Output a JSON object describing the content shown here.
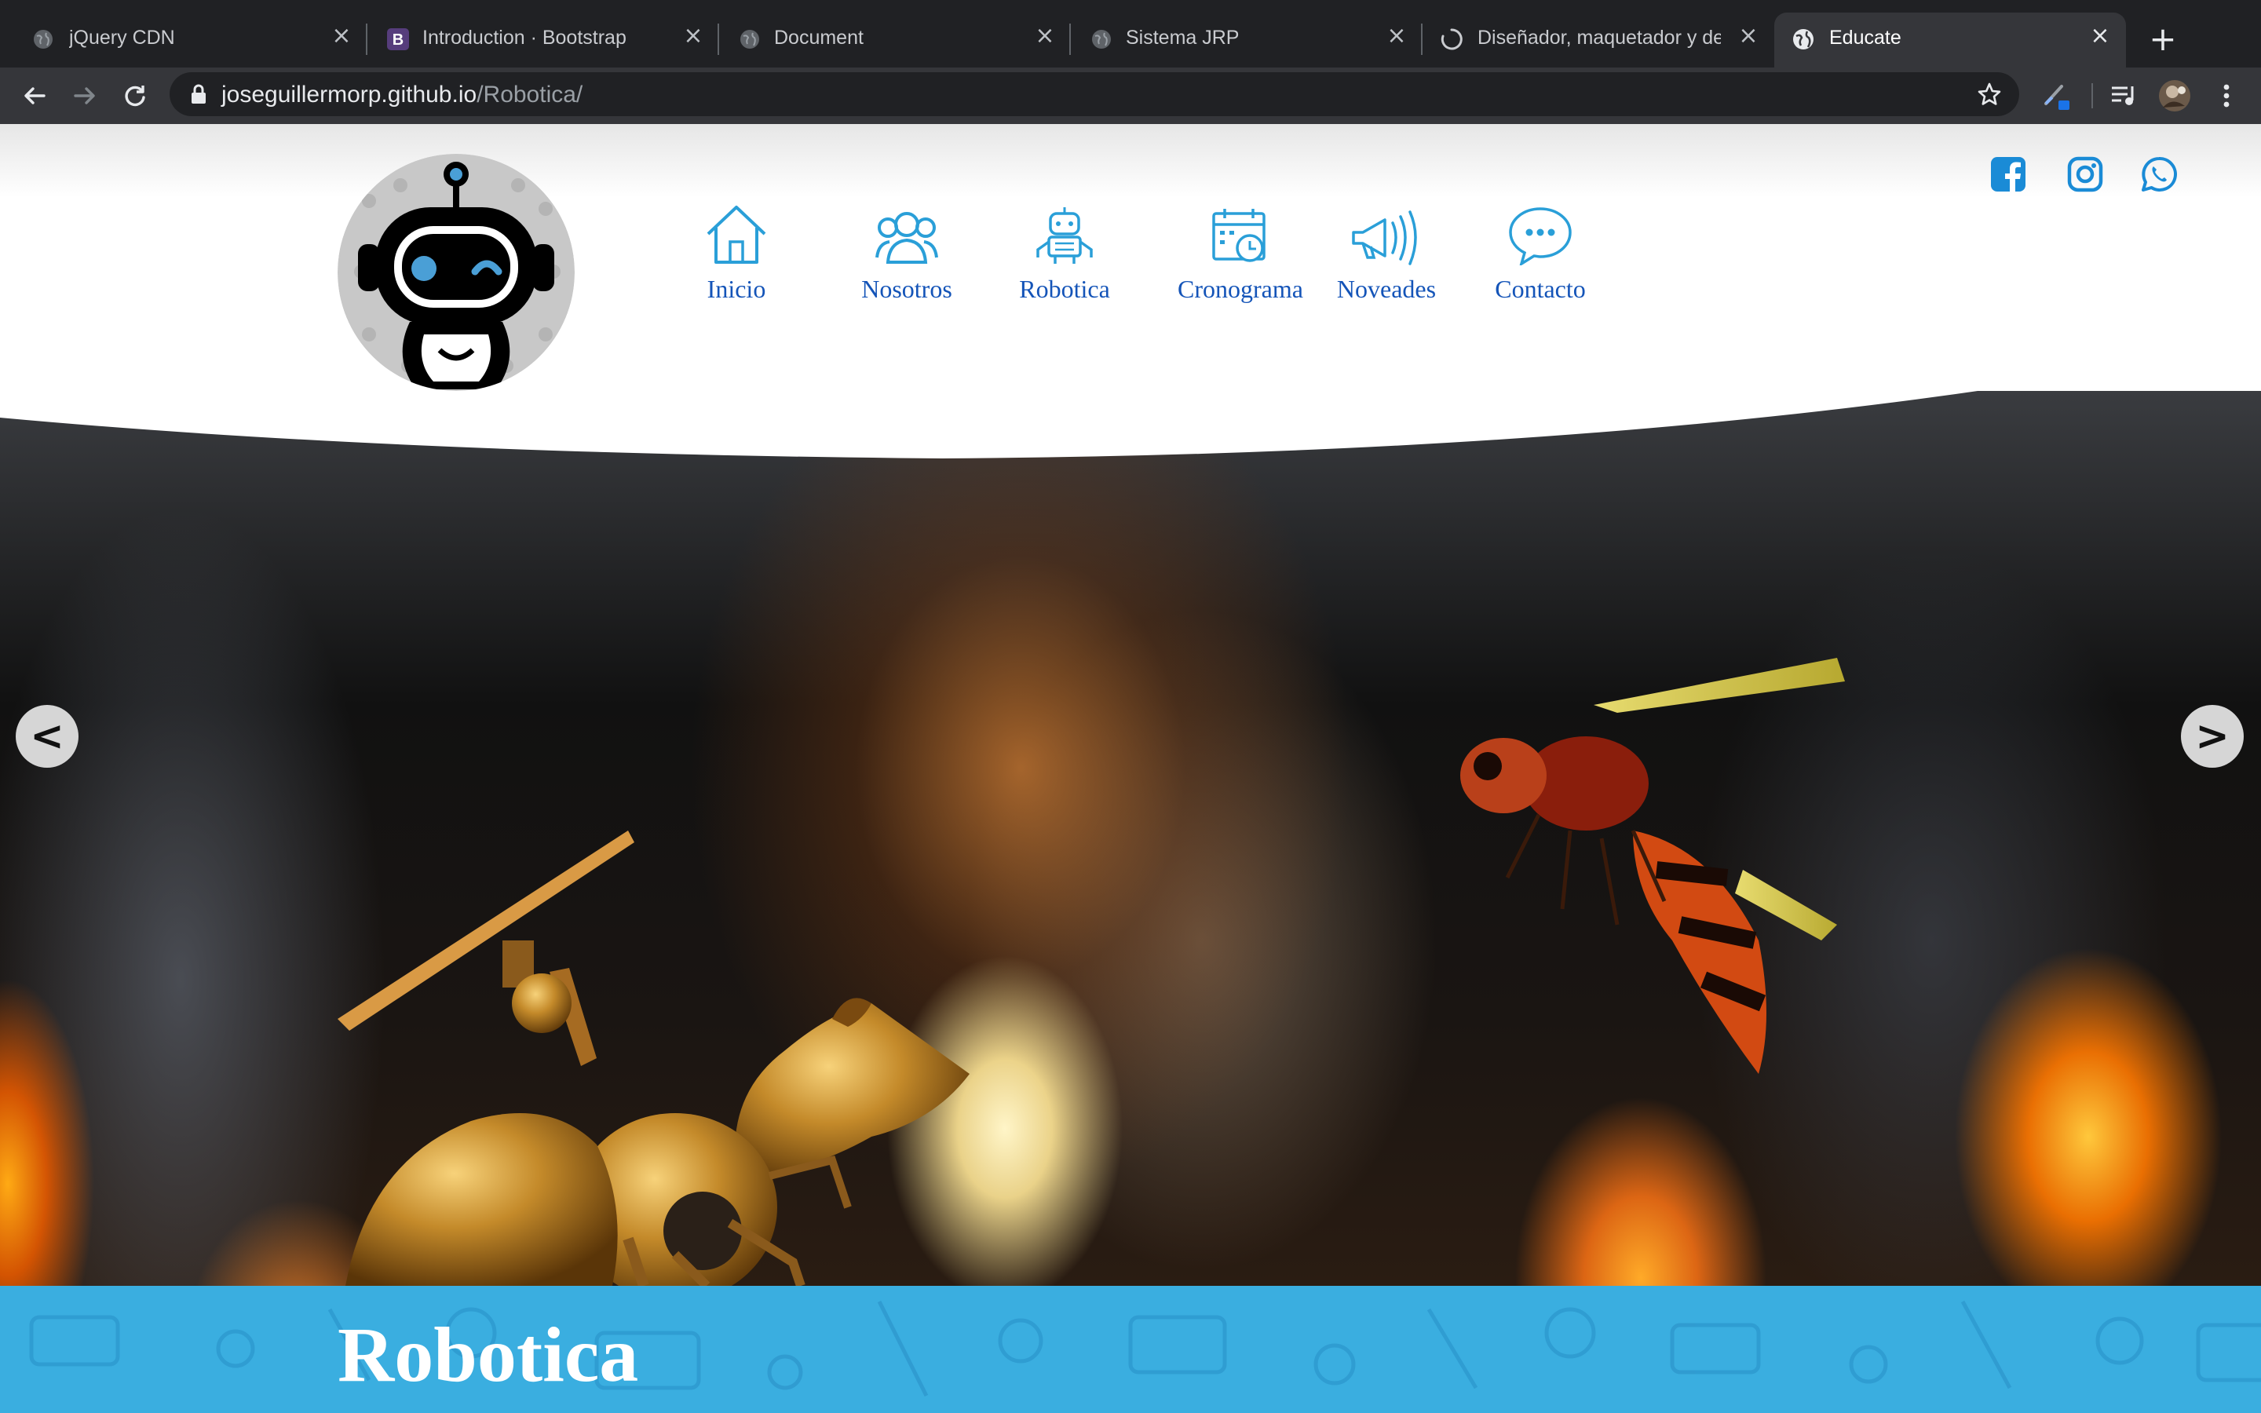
{
  "browser": {
    "tabs": [
      {
        "title": "jQuery CDN",
        "favicon": "globe-icon",
        "active": false
      },
      {
        "title": "Introduction · Bootstrap",
        "favicon": "bootstrap-icon",
        "active": false
      },
      {
        "title": "Document",
        "favicon": "globe-icon",
        "active": false
      },
      {
        "title": "Sistema JRP",
        "favicon": "globe-icon",
        "active": false
      },
      {
        "title": "Diseñador, maquetador y des",
        "favicon": "loading-spinner-icon",
        "active": false
      },
      {
        "title": "Educate",
        "favicon": "globe-icon",
        "active": true
      }
    ],
    "url_host": "joseguillermorp.github.io",
    "url_path": "/Robotica/",
    "colors": {
      "tabbar": "#202124",
      "toolbar": "#35363a",
      "active_tab": "#35363a"
    }
  },
  "site": {
    "logo": "robot-mascot-logo",
    "nav": [
      {
        "label": "Inicio",
        "icon": "home-icon"
      },
      {
        "label": "Nosotros",
        "icon": "people-icon"
      },
      {
        "label": "Robotica",
        "icon": "robot-icon"
      },
      {
        "label": "Cronograma",
        "icon": "calendar-clock-icon"
      },
      {
        "label": "Noveades",
        "icon": "megaphone-icon"
      },
      {
        "label": "Contacto",
        "icon": "chat-bubble-icon"
      }
    ],
    "social": [
      {
        "name": "facebook",
        "icon": "facebook-icon"
      },
      {
        "name": "instagram",
        "icon": "instagram-icon"
      },
      {
        "name": "whatsapp",
        "icon": "whatsapp-icon"
      }
    ],
    "carousel": {
      "prev_label": "<",
      "next_label": ">"
    },
    "section_title": "Robotica",
    "colors": {
      "nav_text": "#1454b8",
      "icon": "#2a9fd8",
      "band": "#3aaee0",
      "social": "#1a8bd6"
    }
  }
}
